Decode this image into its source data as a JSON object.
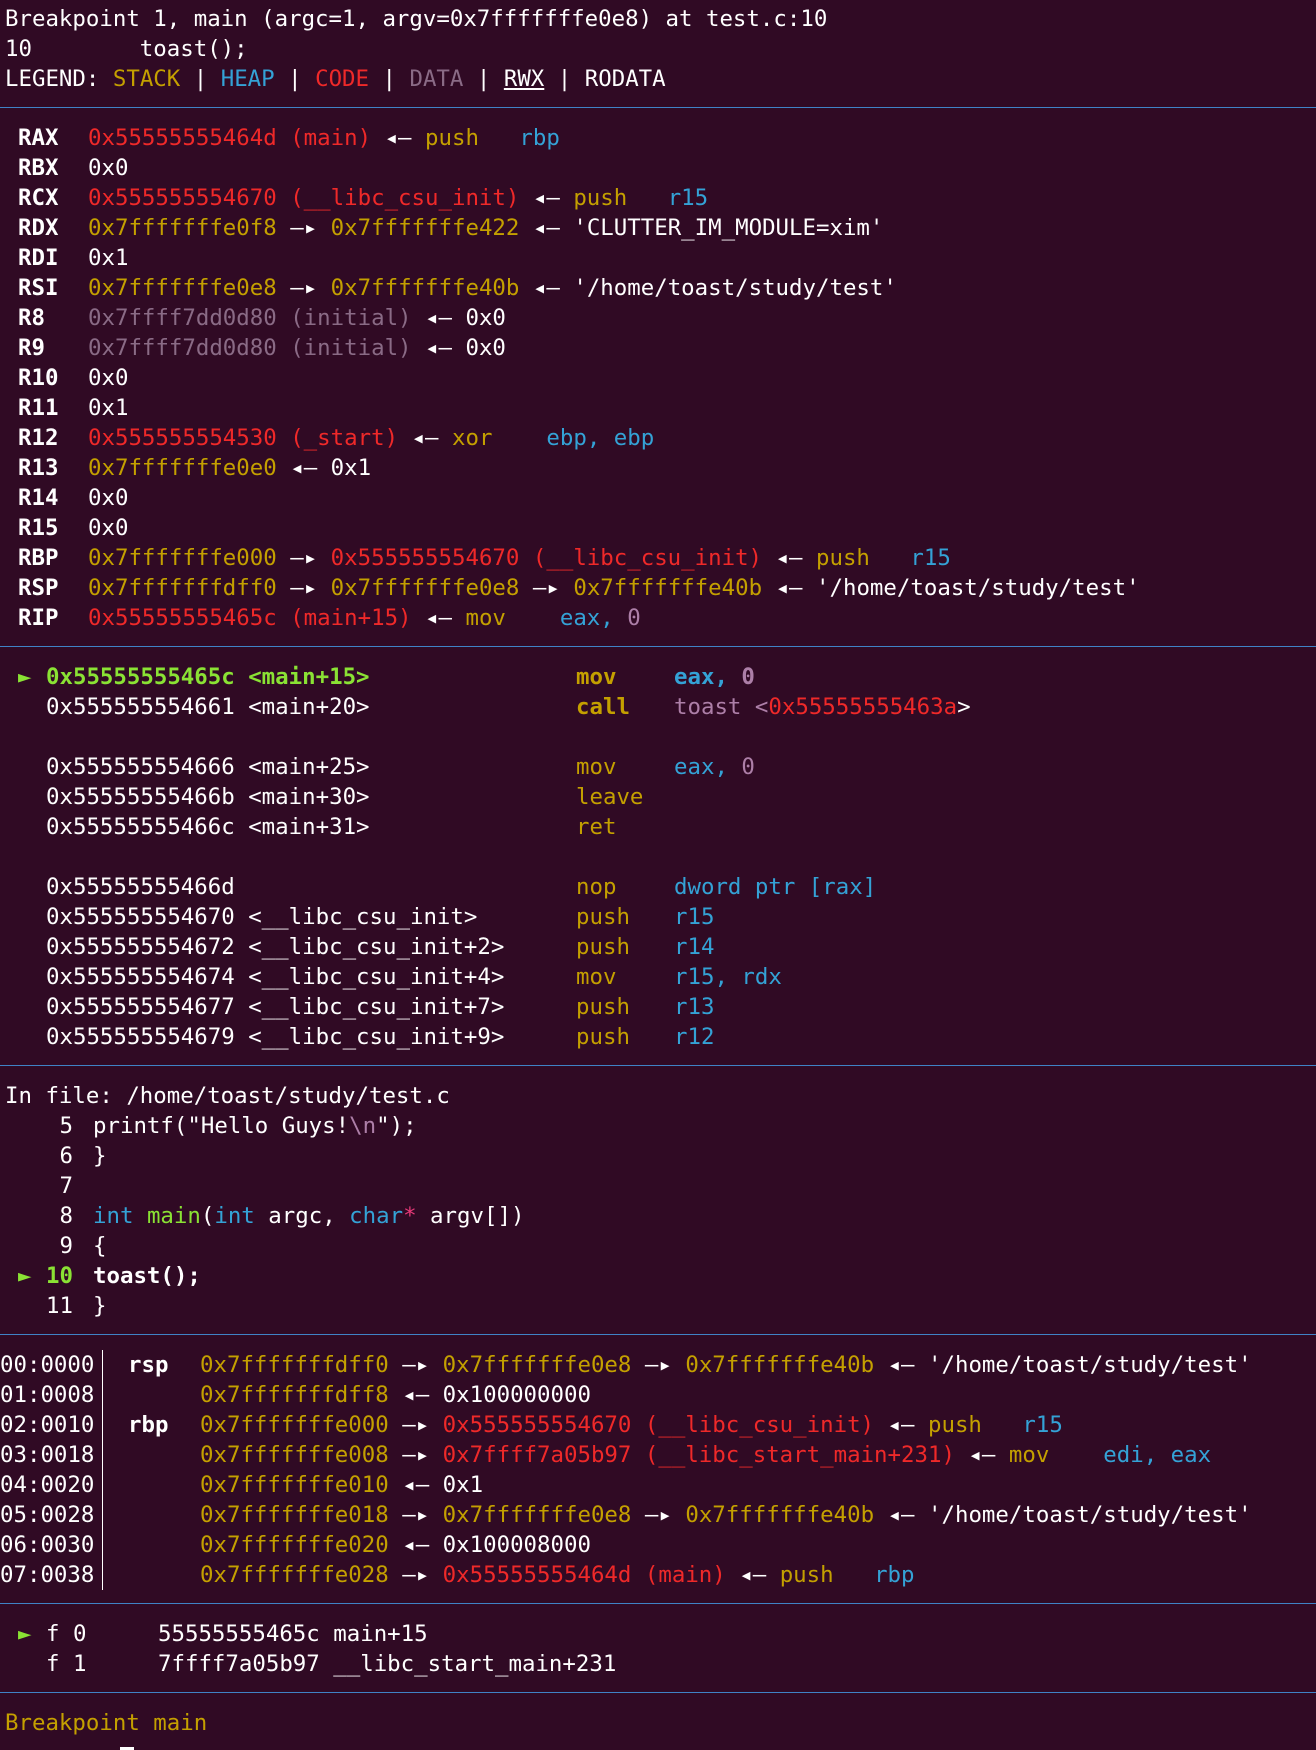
{
  "header": {
    "breakpoint_line": "Breakpoint 1, main (argc=1, argv=0x7fffffffe0e8) at test.c:10",
    "source_line": "10\t  toast();",
    "legend_label": "LEGEND:",
    "legend_stack": "STACK",
    "legend_heap": "HEAP",
    "legend_code": "CODE",
    "legend_data": "DATA",
    "legend_rwx": "RWX",
    "legend_rodata": "RODATA",
    "pipe": "|"
  },
  "arrows": {
    "right": "—▸",
    "left": "◂—"
  },
  "registers": [
    {
      "name": "RAX",
      "a": "0x55555555464d (main)",
      "ins": "push",
      "op": "rbp"
    },
    {
      "name": "RBX",
      "v": "0x0"
    },
    {
      "name": "RCX",
      "a": "0x555555554670 (__libc_csu_init)",
      "ins": "push",
      "op": "r15"
    },
    {
      "name": "RDX",
      "a": "0x7fffffffe0f8",
      "b": "0x7fffffffe422",
      "s": "'CLUTTER_IM_MODULE=xim'"
    },
    {
      "name": "RDI",
      "v": "0x1"
    },
    {
      "name": "RSI",
      "a": "0x7fffffffe0e8",
      "b": "0x7fffffffe40b",
      "s": "'/home/toast/study/test'"
    },
    {
      "name": "R8",
      "a": "0x7ffff7dd0d80 (initial)",
      "v": "0x0"
    },
    {
      "name": "R9",
      "a": "0x7ffff7dd0d80 (initial)",
      "v": "0x0"
    },
    {
      "name": "R10",
      "v": "0x0"
    },
    {
      "name": "R11",
      "v": "0x1"
    },
    {
      "name": "R12",
      "a": "0x555555554530 (_start)",
      "ins": "xor",
      "op": "ebp, ebp"
    },
    {
      "name": "R13",
      "a": "0x7fffffffe0e0",
      "v": "0x1"
    },
    {
      "name": "R14",
      "v": "0x0"
    },
    {
      "name": "R15",
      "v": "0x0"
    },
    {
      "name": "RBP",
      "a": "0x7fffffffe000",
      "b": "0x555555554670 (__libc_csu_init)",
      "ins": "push",
      "op": "r15"
    },
    {
      "name": "RSP",
      "a": "0x7fffffffdff0",
      "b": "0x7fffffffe0e8",
      "c": "0x7fffffffe40b",
      "s": "'/home/toast/study/test'"
    },
    {
      "name": "RIP",
      "a": "0x55555555465c (main+15)",
      "ins": "mov",
      "op": "eax, ",
      "imm": "0"
    }
  ],
  "disasm": {
    "current_marker": "►",
    "rows": [
      {
        "addr": "0x55555555465c <main+15>",
        "mn": "mov",
        "op": "eax, ",
        "imm": "0"
      },
      {
        "addr": "0x555555554661 <main+20>",
        "mn": "call",
        "op": "toast <",
        "tgt": "0x55555555463a",
        "tail": ">"
      },
      {
        "addr": "0x555555554666 <main+25>",
        "mn": "mov",
        "op": "eax, ",
        "imm": "0"
      },
      {
        "addr": "0x55555555466b <main+30>",
        "mn": "leave"
      },
      {
        "addr": "0x55555555466c <main+31>",
        "mn": "ret"
      },
      {
        "addr": "0x55555555466d",
        "mn": "nop",
        "op": "dword ptr [rax]"
      },
      {
        "addr": "0x555555554670 <__libc_csu_init>",
        "mn": "push",
        "op": "r15"
      },
      {
        "addr": "0x555555554672 <__libc_csu_init+2>",
        "mn": "push",
        "op": "r14"
      },
      {
        "addr": "0x555555554674 <__libc_csu_init+4>",
        "mn": "mov",
        "op": "r15, rdx"
      },
      {
        "addr": "0x555555554677 <__libc_csu_init+7>",
        "mn": "push",
        "op": "r13"
      },
      {
        "addr": "0x555555554679 <__libc_csu_init+9>",
        "mn": "push",
        "op": "r12"
      }
    ]
  },
  "source": {
    "file_line": "In file: /home/toast/study/test.c",
    "lines": [
      {
        "no": "5",
        "pre": "printf(\"Hello Guys!",
        "esc": "\\n",
        "post": "\");"
      },
      {
        "no": "6",
        "text": "}"
      },
      {
        "no": "7",
        "text": ""
      },
      {
        "no": "8",
        "kw1": "int",
        "fn": "main",
        "p1": "(",
        "kw2": "int",
        "p2": " argc, ",
        "kw3": "char",
        "star": "*",
        "p3": " argv[])"
      },
      {
        "no": "9",
        "text": "{"
      },
      {
        "no": "10",
        "text": "toast();",
        "current": true
      },
      {
        "no": "11",
        "text": "}"
      }
    ]
  },
  "stack": [
    {
      "off": "00:0000",
      "reg": "rsp",
      "a": "0x7fffffffdff0",
      "b": "0x7fffffffe0e8",
      "c": "0x7fffffffe40b",
      "s": "'/home/toast/study/test'"
    },
    {
      "off": "01:0008",
      "a": "0x7fffffffdff8",
      "v": "0x100000000"
    },
    {
      "off": "02:0010",
      "reg": "rbp",
      "a": "0x7fffffffe000",
      "b": "0x555555554670 (__libc_csu_init)",
      "ins": "push",
      "op": "r15"
    },
    {
      "off": "03:0018",
      "a": "0x7fffffffe008",
      "b": "0x7ffff7a05b97 (__libc_start_main+231)",
      "ins": "mov",
      "op": "edi, eax"
    },
    {
      "off": "04:0020",
      "a": "0x7fffffffe010",
      "v": "0x1"
    },
    {
      "off": "05:0028",
      "a": "0x7fffffffe018",
      "b": "0x7fffffffe0e8",
      "c": "0x7fffffffe40b",
      "s": "'/home/toast/study/test'"
    },
    {
      "off": "06:0030",
      "a": "0x7fffffffe020",
      "v": "0x100008000"
    },
    {
      "off": "07:0038",
      "a": "0x7fffffffe028",
      "b": "0x55555555464d (main)",
      "ins": "push",
      "op": "rbp"
    }
  ],
  "backtrace": [
    {
      "f": "f 0",
      "addr": "55555555465c",
      "sym": "main+15",
      "current": true
    },
    {
      "f": "f 1",
      "addr": "7ffff7a05b97",
      "sym": "__libc_start_main+231"
    }
  ],
  "prompt": "Breakpoint main"
}
